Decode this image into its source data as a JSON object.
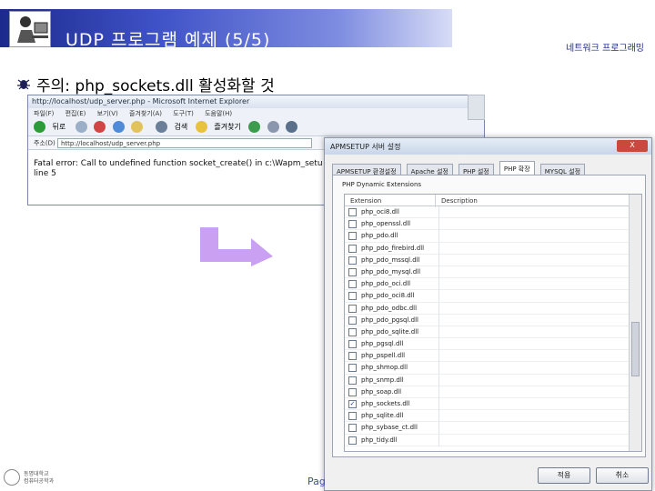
{
  "slide": {
    "title": "UDP 프로그램 예제 (5/5)",
    "header_right": "네트워크 프로그래밍",
    "bullet": "주의: php_sockets.dll 활성화할 것",
    "page_label": "Pag",
    "footer_logo": {
      "line1": "동명대학교",
      "line2": "컴퓨터공학과"
    }
  },
  "browser": {
    "title": "http://localhost/udp_server.php - Microsoft Internet Explorer",
    "menu": [
      "파일(F)",
      "편집(E)",
      "보기(V)",
      "즐겨찾기(A)",
      "도구(T)",
      "도움말(H)"
    ],
    "back_label": "뒤로",
    "search_label": "검색",
    "favorites_label": "즐겨찾기",
    "address_label": "주소(D)",
    "address_value": "http://localhost/udp_server.php",
    "error_line1": "Fatal error: Call to undefined function socket_create() in c:\\Wapm_setu",
    "error_line2": "line 5"
  },
  "dialog": {
    "title": "APMSETUP 서버 설정",
    "close_label": "X",
    "tabs": [
      "APMSETUP 환경설정",
      "Apache 설정",
      "PHP 설정",
      "PHP 확장",
      "MYSQL 설정"
    ],
    "active_tab": 3,
    "group_label": "PHP Dynamic Extensions",
    "col_extension": "Extension",
    "col_description": "Description",
    "extensions": [
      {
        "name": "php_oci8.dll",
        "checked": false
      },
      {
        "name": "php_openssl.dll",
        "checked": false
      },
      {
        "name": "php_pdo.dll",
        "checked": false
      },
      {
        "name": "php_pdo_firebird.dll",
        "checked": false
      },
      {
        "name": "php_pdo_mssql.dll",
        "checked": false
      },
      {
        "name": "php_pdo_mysql.dll",
        "checked": false
      },
      {
        "name": "php_pdo_oci.dll",
        "checked": false
      },
      {
        "name": "php_pdo_oci8.dll",
        "checked": false
      },
      {
        "name": "php_pdo_odbc.dll",
        "checked": false
      },
      {
        "name": "php_pdo_pgsql.dll",
        "checked": false
      },
      {
        "name": "php_pdo_sqlite.dll",
        "checked": false
      },
      {
        "name": "php_pgsql.dll",
        "checked": false
      },
      {
        "name": "php_pspell.dll",
        "checked": false
      },
      {
        "name": "php_shmop.dll",
        "checked": false
      },
      {
        "name": "php_snmp.dll",
        "checked": false
      },
      {
        "name": "php_soap.dll",
        "checked": false
      },
      {
        "name": "php_sockets.dll",
        "checked": true
      },
      {
        "name": "php_sqlite.dll",
        "checked": false
      },
      {
        "name": "php_sybase_ct.dll",
        "checked": false
      },
      {
        "name": "php_tidy.dll",
        "checked": false
      }
    ],
    "ok_label": "적용",
    "cancel_label": "취소"
  },
  "colors": {
    "banner": "#2c3ba8",
    "accent_text": "#1f2d8f",
    "arrow": "#c9a0f2"
  }
}
